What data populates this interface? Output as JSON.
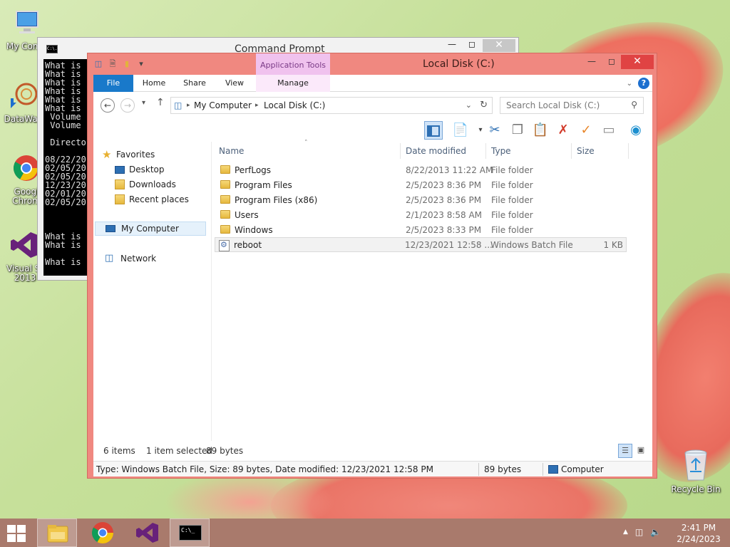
{
  "desktop": {
    "icons": [
      {
        "label": "My Comp"
      },
      {
        "label": "DataWag"
      },
      {
        "label": "Googl Chrom"
      },
      {
        "label": "Visual St 2013"
      }
    ],
    "recycle_bin": "Recycle Bin"
  },
  "cmd": {
    "title": "Command Prompt",
    "icon_text": "C:\\.",
    "lines": [
      "What is",
      "What is",
      "What is",
      "What is",
      "What is",
      "What is",
      " Volume",
      " Volume",
      "",
      " Directo",
      "",
      "08/22/20",
      "02/05/20",
      "02/05/20",
      "12/23/20",
      "02/01/20",
      "02/05/20",
      "",
      "",
      "",
      "What is",
      "What is",
      "",
      "What is"
    ]
  },
  "explorer": {
    "title": "Local Disk (C:)",
    "contextual_tab": "Application Tools",
    "tabs": [
      "File",
      "Home",
      "Share",
      "View",
      "Manage"
    ],
    "address": {
      "items": [
        "My Computer",
        "Local Disk (C:)"
      ]
    },
    "search": {
      "placeholder": "Search Local Disk (C:)"
    },
    "nav_pane": {
      "favorites": "Favorites",
      "favorites_items": [
        "Desktop",
        "Downloads",
        "Recent places"
      ],
      "my_computer": "My Computer",
      "network": "Network"
    },
    "columns": [
      "Name",
      "Date modified",
      "Type",
      "Size"
    ],
    "files": [
      {
        "name": "PerfLogs",
        "date": "8/22/2013 11:22 AM",
        "type": "File folder",
        "size": "",
        "kind": "folder"
      },
      {
        "name": "Program Files",
        "date": "2/5/2023 8:36 PM",
        "type": "File folder",
        "size": "",
        "kind": "folder"
      },
      {
        "name": "Program Files (x86)",
        "date": "2/5/2023 8:36 PM",
        "type": "File folder",
        "size": "",
        "kind": "folder"
      },
      {
        "name": "Users",
        "date": "2/1/2023 8:58 AM",
        "type": "File folder",
        "size": "",
        "kind": "folder"
      },
      {
        "name": "Windows",
        "date": "2/5/2023 8:33 PM",
        "type": "File folder",
        "size": "",
        "kind": "folder"
      },
      {
        "name": "reboot",
        "date": "12/23/2021 12:58 ...",
        "type": "Windows Batch File",
        "size": "1 KB",
        "kind": "batch"
      }
    ],
    "items_bar": {
      "count": "6 items",
      "selected": "1 item selected",
      "selected_size": "89 bytes"
    },
    "status_bar": {
      "details": "Type: Windows Batch File, Size: 89 bytes, Date modified: 12/23/2021 12:58 PM",
      "size": "89 bytes",
      "location": "Computer"
    }
  },
  "taskbar": {
    "time": "2:41 PM",
    "date": "2/24/2023",
    "cmd_icon_text": "C:\\_"
  }
}
